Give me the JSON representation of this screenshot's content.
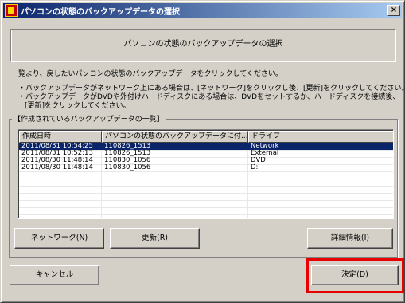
{
  "window": {
    "title": "パソコンの状態のバックアップデータの選択",
    "close_label": "×"
  },
  "banner": {
    "text": "パソコンの状態のバックアップデータの選択"
  },
  "instructions": {
    "line1": "一覧より、戻したいパソコンの状態のバックアップデータをクリックしてください。",
    "line2": "・バックアップデータがネットワーク上にある場合は、[ネットワーク]をクリックし後、[更新]をクリックしてください。",
    "line3": "・バックアップデータがDVDや外付けハードディスクにある場合は、DVDをセットするか、ハードディスクを接続後、",
    "line4": "[更新]をクリックしてください。"
  },
  "group": {
    "label": "【作成されているバックアップデータの一覧】",
    "columns": [
      "作成日時",
      "パソコンの状態のバックアップデータに付...",
      "ドライブ"
    ],
    "rows": [
      {
        "date": "2011/08/31 10:54:25",
        "name": "110826_1513",
        "drive": "Network",
        "selected": true
      },
      {
        "date": "2011/08/31 10:52:13",
        "name": "110826_1513",
        "drive": "External",
        "selected": false
      },
      {
        "date": "2011/08/30 11:48:14",
        "name": "110830_1056",
        "drive": "DVD",
        "selected": false
      },
      {
        "date": "2011/08/30 11:48:14",
        "name": "110830_1056",
        "drive": "D:",
        "selected": false
      }
    ]
  },
  "buttons": {
    "network": "ネットワーク(N)",
    "refresh": "更新(R)",
    "details": "詳細情報(I)",
    "cancel": "キャンセル",
    "ok": "決定(D)"
  },
  "colors": {
    "selection": "#0a246a",
    "highlight_frame": "#e60000",
    "window_face": "#d4d0c8"
  }
}
